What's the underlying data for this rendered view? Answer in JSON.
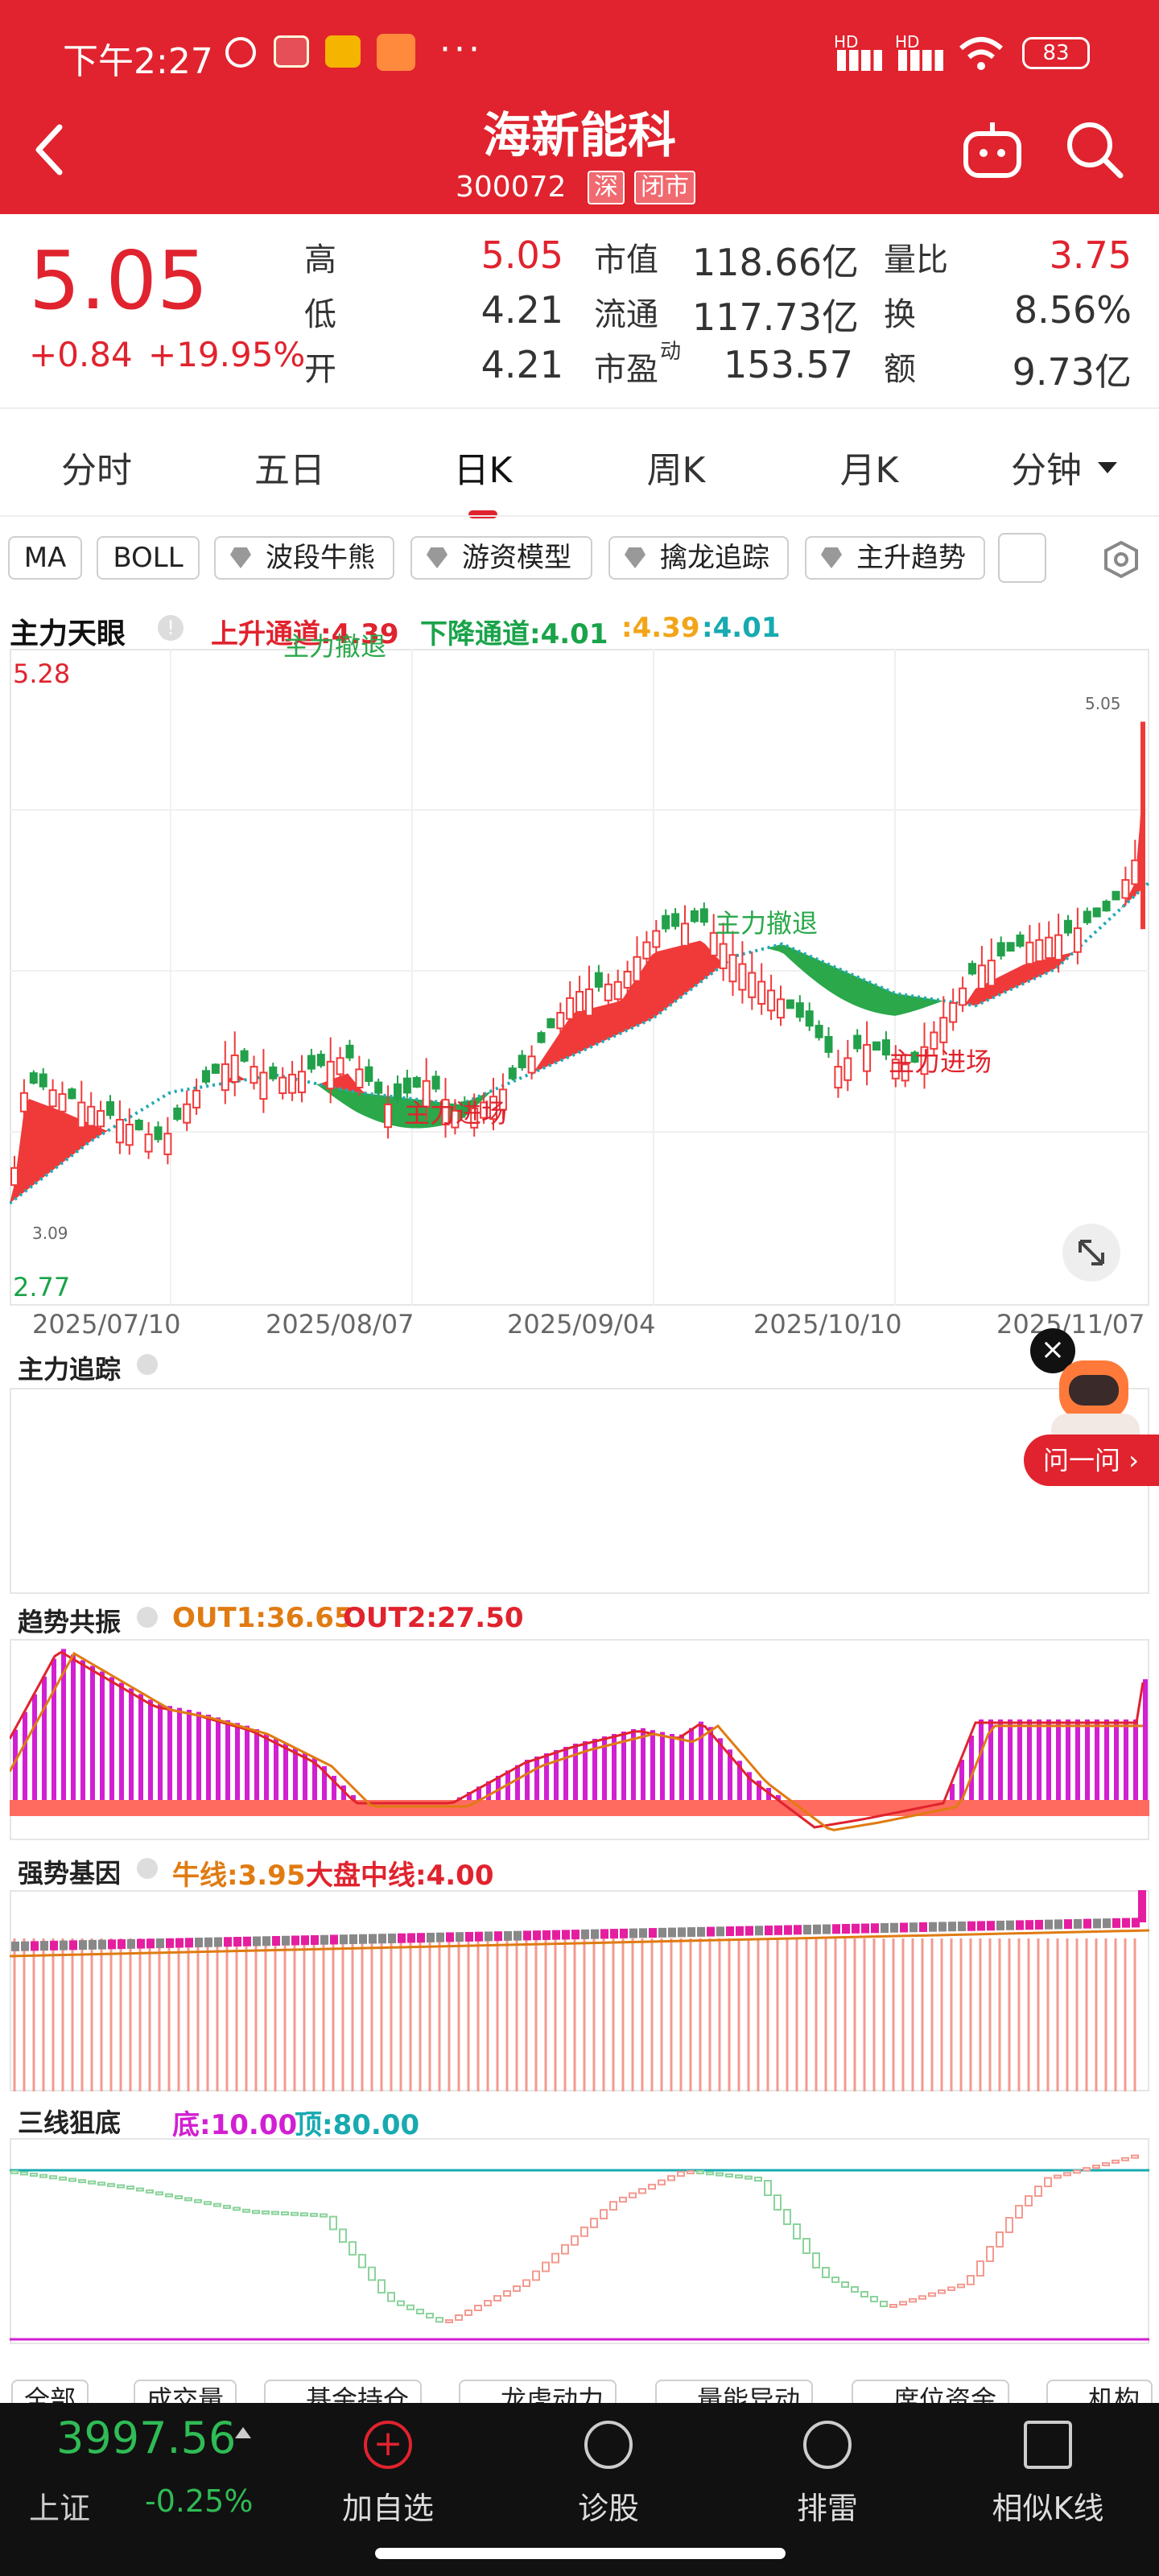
{
  "status": {
    "time": "下午2:27",
    "dots": "···",
    "signal1": "HD",
    "signal2": "HD",
    "battery": "83"
  },
  "header": {
    "title": "海新能科",
    "code": "300072",
    "exchange": "深",
    "market_state": "闭市"
  },
  "quote": {
    "price": "5.05",
    "change": "+0.84",
    "change_pct": "+19.95%",
    "rows": [
      {
        "l1": "高",
        "v1": "5.05",
        "l2": "市值",
        "v2": "118.66亿",
        "l3": "量比",
        "v3": "3.75"
      },
      {
        "l1": "低",
        "v1": "4.21",
        "l2": "流通",
        "v2": "117.73亿",
        "l3": "换",
        "v3": "8.56%"
      },
      {
        "l1": "开",
        "v1": "4.21",
        "l2": "市盈",
        "l2sup": "动",
        "v2": "153.57",
        "l3": "额",
        "v3": "9.73亿"
      }
    ]
  },
  "tabs": [
    "分时",
    "五日",
    "日K",
    "周K",
    "月K",
    "分钟"
  ],
  "active_tab": "日K",
  "chips": [
    "MA",
    "BOLL",
    "波段牛熊",
    "游资模型",
    "擒龙追踪",
    "主升趋势"
  ],
  "main_chart": {
    "title": "主力天眼",
    "up_label": "上升通道:4.39",
    "down_label": "下降通道:4.01",
    "v1": ":4.39",
    "v2": ":4.01",
    "y_max": "5.28",
    "y_min": "2.77",
    "hi_mark": "5.05",
    "lo_mark": "3.09",
    "ann_exit": "主力撤退",
    "ann_enter": "主力进场",
    "dates": [
      "2025/07/10",
      "2025/08/07",
      "2025/09/04",
      "2025/10/10",
      "2025/11/07"
    ]
  },
  "panel2": {
    "title": "主力追踪"
  },
  "panel3": {
    "title": "趋势共振",
    "out1": "OUT1:36.65",
    "out2": "OUT2:27.50"
  },
  "panel4": {
    "title": "强势基因",
    "l1": "牛线:3.95",
    "l2": "大盘中线:4.00"
  },
  "panel5": {
    "title": "三线狙底",
    "l1": "底:10.00",
    "l2": "顶:80.00"
  },
  "bottom_chips": [
    "全部",
    "成交量",
    "基金持仓",
    "龙虎动力",
    "量能异动",
    "席位资金",
    "机构"
  ],
  "ask": {
    "label": "问一问"
  },
  "index": {
    "value": "3997.56",
    "name": "上证",
    "change": "-0.25%"
  },
  "nav": [
    "加自选",
    "诊股",
    "排雷",
    "相似K线"
  ],
  "colors": {
    "brand": "#e0232e",
    "up": "#f03030",
    "down": "#22a04a",
    "magenta": "#d21fd2"
  },
  "chart_data": {
    "type": "candlestick",
    "close_last": 5.05,
    "y_range": [
      2.77,
      5.28
    ],
    "x_dates": [
      "2025/07/10",
      "2025/08/07",
      "2025/09/04",
      "2025/10/10",
      "2025/11/07"
    ]
  }
}
